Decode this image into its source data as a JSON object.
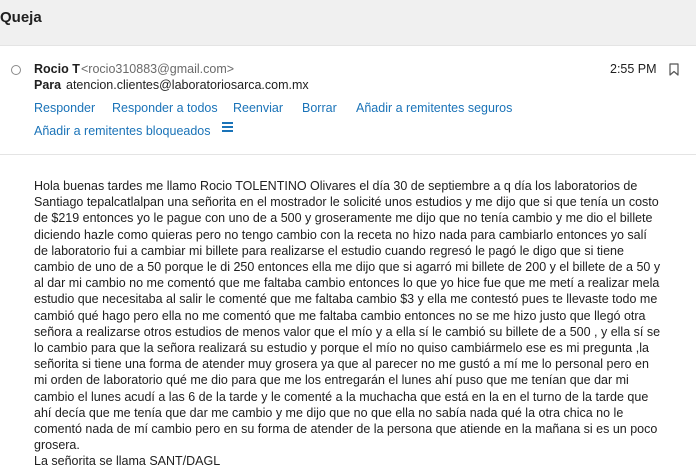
{
  "email": {
    "subject": "Queja",
    "sender_name": "Rocio T",
    "sender_email": "<rocio310883@gmail.com>",
    "to_label": "Para",
    "to_value": "atencion.clientes@laboratoriosarca.com.mx",
    "time": "2:55 PM"
  },
  "actions": {
    "reply": "Responder",
    "reply_all": "Responder a todos",
    "forward": "Reenviar",
    "delete": "Borrar",
    "add_safe": "Añadir a remitentes seguros",
    "add_blocked": "Añadir a remitentes bloqueados"
  },
  "body": {
    "paragraph": "Hola buenas tardes me llamo Rocio TOLENTINO Olivares el día 30 de septiembre a q día los laboratorios de Santiago tepalcatlalpan una señorita en el mostrador le solicité unos estudios y me dijo que si que tenía un costo de $219 entonces yo le pague con uno de a 500 y groseramente me dijo que no tenía cambio y me dio el billete diciendo hazle como quieras pero no tengo cambio con la receta no hizo nada para cambiarlo entonces yo salí de laboratorio fui a cambiar mi billete para realizarse el estudio cuando regresó le pagó le digo que si tiene cambio de uno de a 50 porque le di 250 entonces ella me dijo que si agarró mi billete de 200 y el billete de a 50 y al dar mi cambio no me comentó que me faltaba cambio entonces lo que yo hice fue que me metí a realizar mela estudio que necesitaba al salir le comenté que me faltaba cambio $3 y ella me contestó pues te llevaste todo me cambió qué hago pero ella no me comentó que me faltaba cambio entonces no se me hizo justo que llegó otra señora a realizarse otros estudios de menos valor que el mío y a ella sí le cambió su billete de a 500 , y ella sí se lo cambio para que la señora realizará su estudio y porque el mío no quiso cambiármelo ese es mi pregunta ,la señorita si tiene una forma de atender muy grosera ya que al parecer no me gustó a mí me lo personal pero en mi orden de laboratorio qué me dio para que me los entregarán el lunes ahí puso que me tenían que dar mi cambio el lunes acudí a las 6 de la tarde y le comenté a la muchacha que está en la en el turno de la tarde que ahí decía que me tenía que dar me cambio y me dijo que no que ella no sabía nada qué la otra chica no le comentó nada de mí cambio pero en su forma de atender de la persona que atiende en la mañana si es un poco grosera.",
    "closing": "La señorita se llama SANT/DAGL"
  },
  "icons": {
    "radio": "radio-circle-icon",
    "bookmark": "bookmark-icon",
    "more": "hamburger-menu-icon"
  },
  "colors": {
    "link": "#1a73b8",
    "header_bg": "#f0f0f0"
  }
}
